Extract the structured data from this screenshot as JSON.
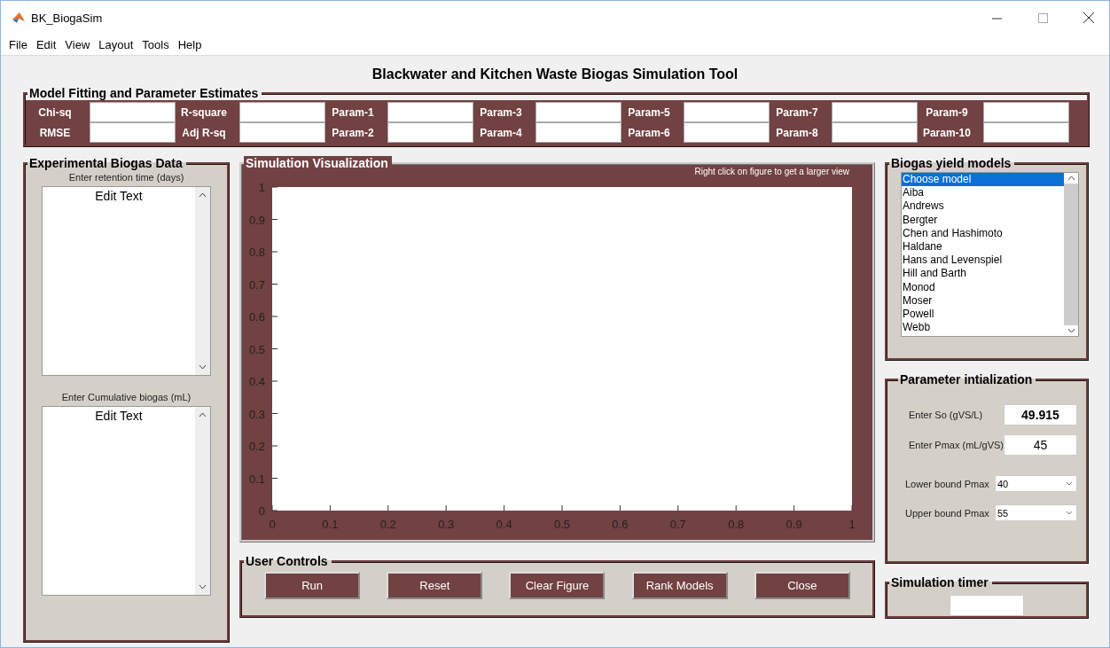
{
  "window": {
    "title": "BK_BiogaSim"
  },
  "menu": [
    "File",
    "Edit",
    "View",
    "Layout",
    "Tools",
    "Help"
  ],
  "heading": "Blackwater and Kitchen Waste Biogas Simulation Tool",
  "fitting": {
    "title": "Model Fitting and Parameter Estimates",
    "columns": [
      {
        "labels": [
          "Chi-sq",
          "RMSE"
        ]
      },
      {
        "labels": [
          "R-square",
          "Adj R-sq"
        ]
      },
      {
        "labels": [
          "Param-1",
          "Param-2"
        ]
      },
      {
        "labels": [
          "Param-3",
          "Param-4"
        ]
      },
      {
        "labels": [
          "Param-5",
          "Param-6"
        ]
      },
      {
        "labels": [
          "Param-7",
          "Param-8"
        ]
      },
      {
        "labels": [
          "Param-9",
          "Param-10"
        ]
      }
    ]
  },
  "experimental": {
    "title": "Experimental Biogas Data",
    "inputs": [
      {
        "label": "Enter retention time (days)",
        "value": "Edit Text"
      },
      {
        "label": "Enter Cumulative biogas (mL)",
        "value": "Edit Text"
      }
    ]
  },
  "visualization": {
    "title": "Simulation Visualization",
    "hint": "Right click on figure to get a larger view",
    "chart_data": {
      "type": "line",
      "xlim": [
        0,
        1
      ],
      "ylim": [
        0,
        1
      ],
      "xticks": [
        0,
        0.1,
        0.2,
        0.3,
        0.4,
        0.5,
        0.6,
        0.7,
        0.8,
        0.9,
        1
      ],
      "yticks": [
        0,
        0.1,
        0.2,
        0.3,
        0.4,
        0.5,
        0.6,
        0.7,
        0.8,
        0.9,
        1
      ]
    }
  },
  "controls": {
    "title": "User Controls",
    "buttons": [
      "Run",
      "Reset",
      "Clear Figure",
      "Rank Models",
      "Close"
    ]
  },
  "models": {
    "title": "Biogas yield models",
    "items": [
      {
        "label": "Choose model",
        "selected": true
      },
      {
        "label": "Aiba",
        "selected": false
      },
      {
        "label": "Andrews",
        "selected": false
      },
      {
        "label": "Bergter",
        "selected": false
      },
      {
        "label": "Chen and Hashimoto",
        "selected": false
      },
      {
        "label": "Haldane",
        "selected": false
      },
      {
        "label": "Hans and Levenspiel",
        "selected": false
      },
      {
        "label": "Hill and Barth",
        "selected": false
      },
      {
        "label": "Monod",
        "selected": false
      },
      {
        "label": "Moser",
        "selected": false
      },
      {
        "label": "Powell",
        "selected": false
      },
      {
        "label": "Webb",
        "selected": false
      }
    ]
  },
  "parameters": {
    "title": "Parameter intialization",
    "fields": [
      {
        "kind": "text",
        "label": "Enter So (gVS/L)",
        "value": "49.915"
      },
      {
        "kind": "text",
        "label": "Enter Pmax (mL/gVS)",
        "value": "45"
      },
      {
        "kind": "dropdown",
        "label": "Lower bound Pmax",
        "value": "40"
      },
      {
        "kind": "dropdown",
        "label": "Upper bound Pmax",
        "value": "55"
      }
    ]
  },
  "timer": {
    "title": "Simulation timer"
  }
}
